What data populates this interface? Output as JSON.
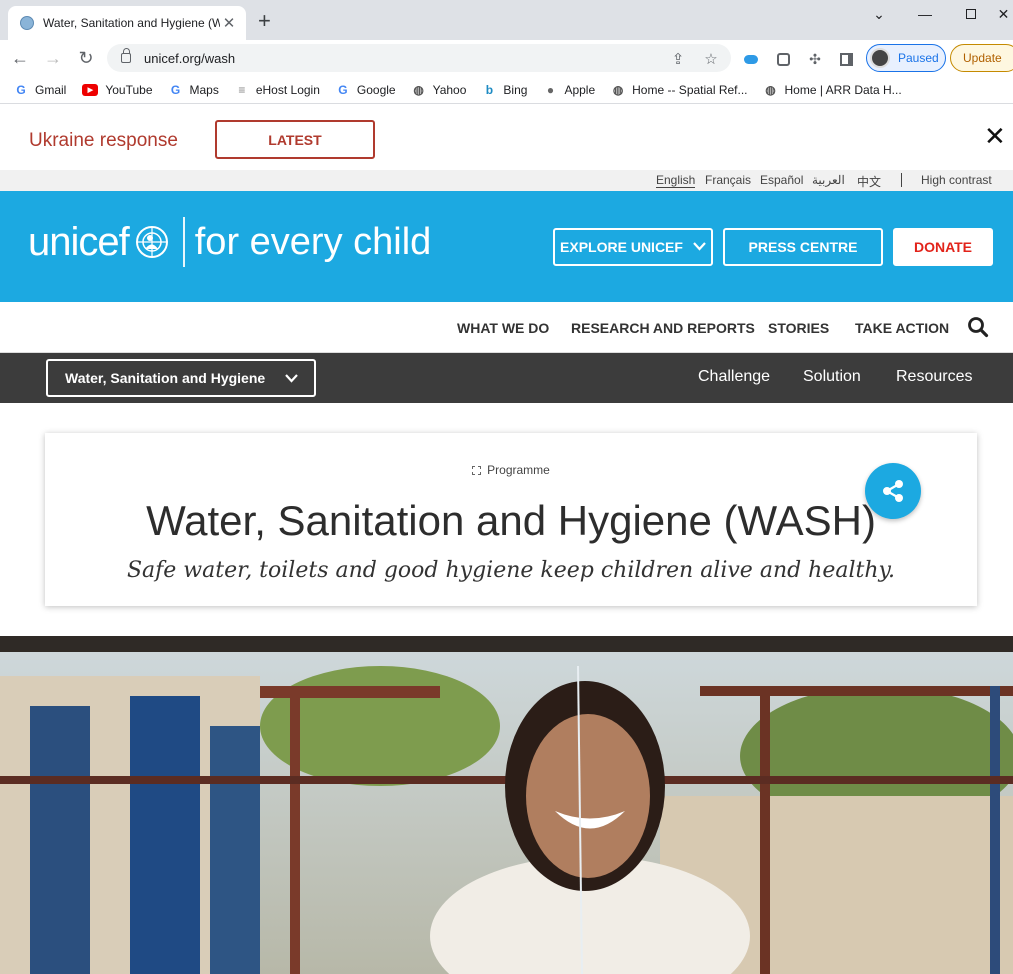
{
  "browser": {
    "tab_title": "Water, Sanitation and Hygiene (WASH) | UNICEF",
    "url": "unicef.org/wash",
    "profile_status": "Paused",
    "update_label": "Update",
    "bookmarks": [
      {
        "label": "Gmail",
        "icon": "google-icon"
      },
      {
        "label": "YouTube",
        "icon": "youtube-icon"
      },
      {
        "label": "Maps",
        "icon": "google-icon"
      },
      {
        "label": "eHost Login",
        "icon": "ehost-icon"
      },
      {
        "label": "Google",
        "icon": "google-icon"
      },
      {
        "label": "Yahoo",
        "icon": "globe-icon"
      },
      {
        "label": "Bing",
        "icon": "bing-icon"
      },
      {
        "label": "Apple",
        "icon": "apple-icon"
      },
      {
        "label": "Home -- Spatial Ref...",
        "icon": "globe-icon"
      },
      {
        "label": "Home | ARR Data H...",
        "icon": "globe-icon"
      }
    ]
  },
  "alert": {
    "text": "Ukraine response",
    "button": "LATEST"
  },
  "languages": [
    "English",
    "Français",
    "Español",
    "العربية",
    "中文"
  ],
  "high_contrast": "High contrast",
  "header": {
    "logo_word": "unicef",
    "tagline": "for every child",
    "explore": "EXPLORE UNICEF",
    "press": "PRESS CENTRE",
    "donate": "DONATE"
  },
  "nav": [
    "WHAT WE DO",
    "RESEARCH AND REPORTS",
    "STORIES",
    "TAKE ACTION"
  ],
  "subnav": {
    "selected": "Water, Sanitation and Hygiene",
    "links": [
      "Challenge",
      "Solution",
      "Resources"
    ]
  },
  "card": {
    "label": "Programme",
    "title": "Water, Sanitation and Hygiene (WASH)",
    "subtitle": "Safe water, toilets and good hygiene keep children alive and healthy."
  },
  "colors": {
    "brand_blue": "#1ca9e1",
    "alert_red": "#b03a2e",
    "donate_red": "#e2231a",
    "subnav_dark": "#3c3c3c"
  }
}
